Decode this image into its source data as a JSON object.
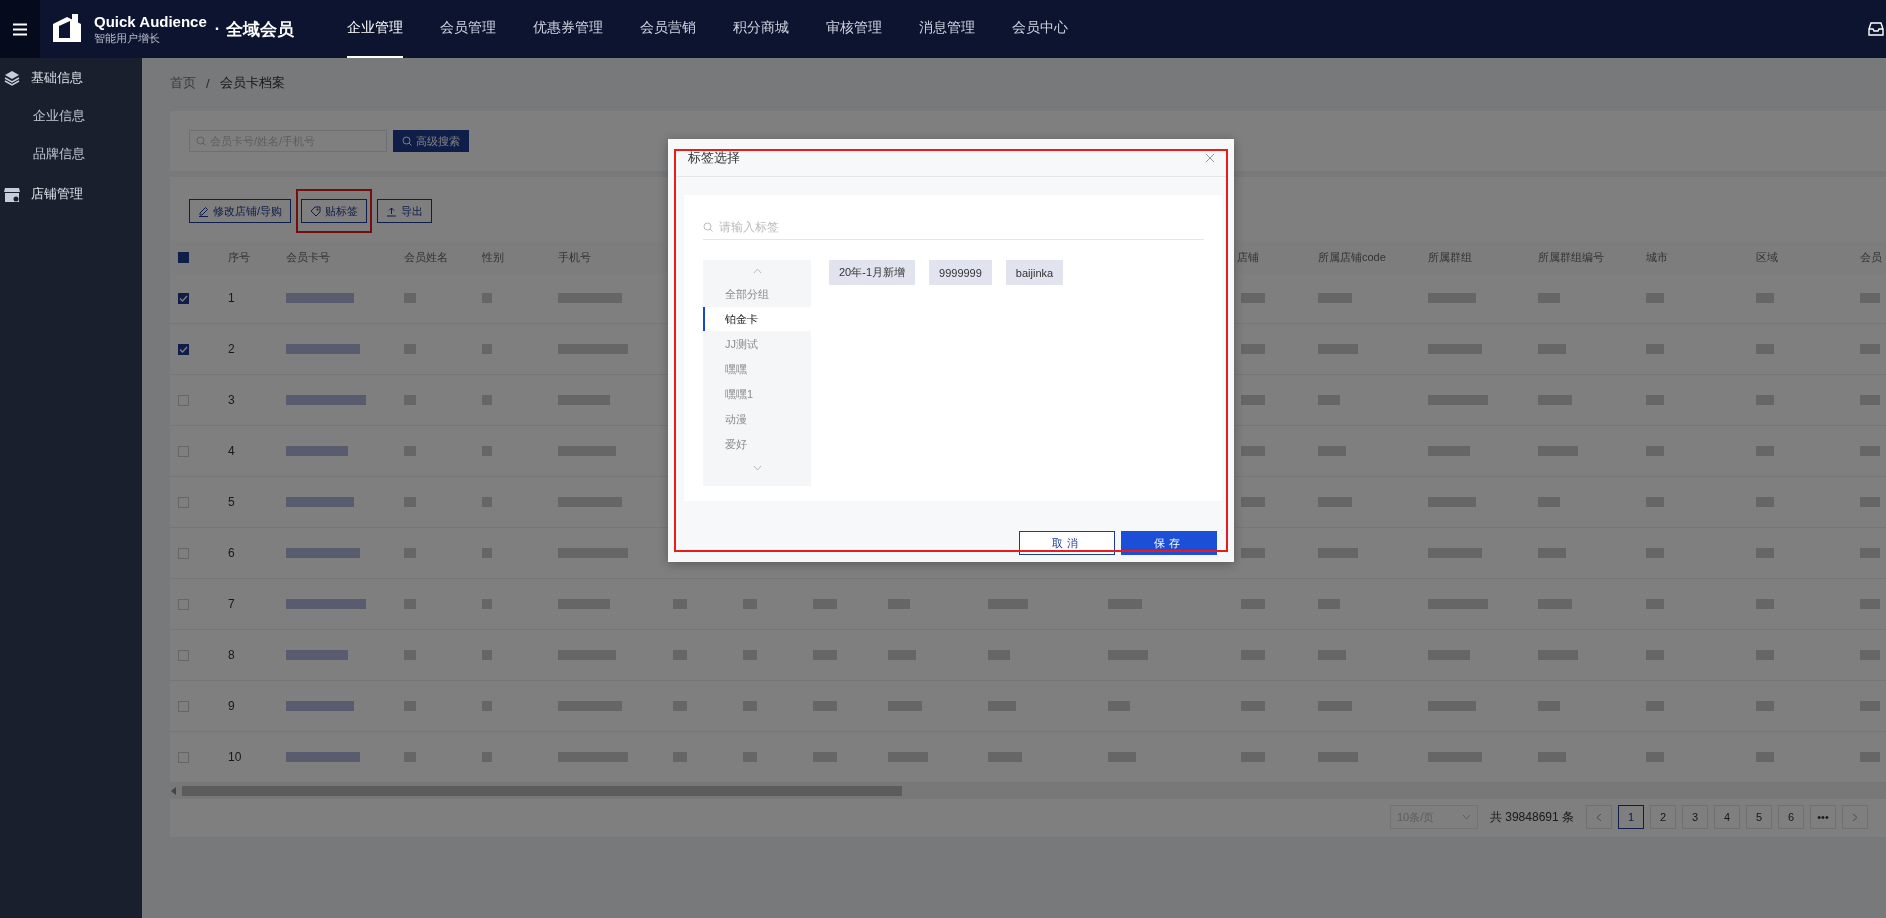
{
  "top_bar": {
    "brand": {
      "name": "Quick Audience",
      "tagline": "智能用户增长",
      "separator": "·",
      "product": "全域会员"
    },
    "nav": [
      {
        "label": "企业管理",
        "selected": true
      },
      {
        "label": "会员管理",
        "selected": false
      },
      {
        "label": "优惠券管理",
        "selected": false
      },
      {
        "label": "会员营销",
        "selected": false
      },
      {
        "label": "积分商城",
        "selected": false
      },
      {
        "label": "审核管理",
        "selected": false
      },
      {
        "label": "消息管理",
        "selected": false
      },
      {
        "label": "会员中心",
        "selected": false
      }
    ]
  },
  "sidebar": {
    "items": [
      {
        "label": "基础信息",
        "kind": "layers",
        "children": [
          {
            "label": "企业信息"
          },
          {
            "label": "品牌信息"
          }
        ]
      },
      {
        "label": "店铺管理",
        "kind": "store"
      }
    ]
  },
  "breadcrumb": {
    "items": [
      "首页",
      "会员卡档案"
    ],
    "separator": "/"
  },
  "search": {
    "placeholder": "会员卡号/姓名/手机号",
    "button": "高级搜索"
  },
  "toolbar": {
    "buttons": [
      {
        "label": "修改店铺/导购",
        "kind": "edit",
        "highlighted": false
      },
      {
        "label": "贴标签",
        "kind": "tag",
        "highlighted": true
      },
      {
        "label": "导出",
        "kind": "export",
        "highlighted": false
      }
    ]
  },
  "table": {
    "select_all": true,
    "columns": [
      "序号",
      "会员卡号",
      "会员姓名",
      "性别",
      "手机号",
      "店铺",
      "所属店铺code",
      "所属群组",
      "所属群组编号",
      "城市",
      "区域",
      "会员"
    ],
    "rows": [
      {
        "index": "1",
        "checked": true
      },
      {
        "index": "2",
        "checked": true
      },
      {
        "index": "3",
        "checked": false
      },
      {
        "index": "4",
        "checked": false
      },
      {
        "index": "5",
        "checked": false
      },
      {
        "index": "6",
        "checked": false
      },
      {
        "index": "7",
        "checked": false
      },
      {
        "index": "8",
        "checked": false
      },
      {
        "index": "9",
        "checked": false
      },
      {
        "index": "10",
        "checked": false
      }
    ]
  },
  "pagination": {
    "page_size": "10条/页",
    "total": "共 39848691 条",
    "pages": [
      {
        "label": "1",
        "selected": true
      },
      {
        "label": "2",
        "selected": false
      },
      {
        "label": "3",
        "selected": false
      },
      {
        "label": "4",
        "selected": false
      },
      {
        "label": "5",
        "selected": false
      },
      {
        "label": "6",
        "selected": false
      },
      {
        "label": "•••",
        "selected": false
      }
    ]
  },
  "dialog": {
    "title": "标签选择",
    "highlighted": true,
    "search_placeholder": "请输入标签",
    "groups": [
      {
        "label": "全部分组",
        "selected": false
      },
      {
        "label": "铂金卡",
        "selected": true
      },
      {
        "label": "JJ测试",
        "selected": false
      },
      {
        "label": "嘿嘿",
        "selected": false
      },
      {
        "label": "嘿嘿1",
        "selected": false
      },
      {
        "label": "动漫",
        "selected": false
      },
      {
        "label": "爱好",
        "selected": false
      }
    ],
    "tags": [
      "20年-1月新增",
      "9999999",
      "baijinka"
    ],
    "buttons": [
      {
        "label": "取消",
        "kind": "secondary"
      },
      {
        "label": "保存",
        "kind": "primary"
      }
    ]
  }
}
